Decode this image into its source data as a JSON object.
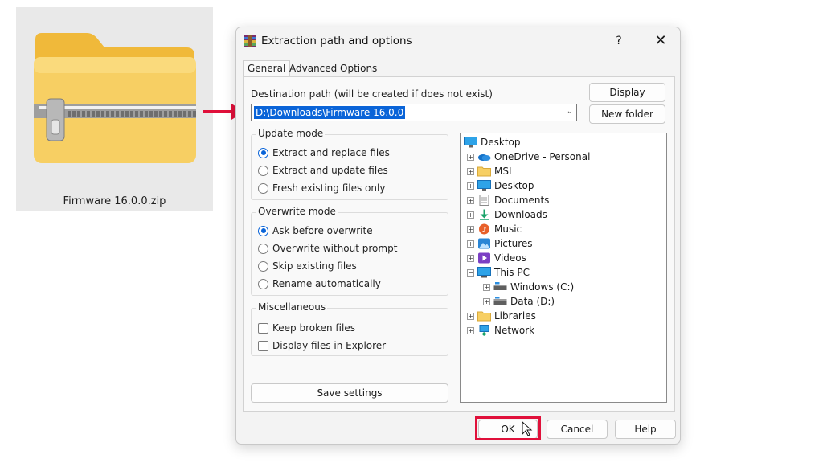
{
  "file_preview": {
    "name": "Firmware 16.0.0.zip",
    "icon": "zip-folder-icon"
  },
  "annotation": {
    "arrow_color": "#e0103a",
    "highlight_color": "#e0103a"
  },
  "dialog": {
    "title": "Extraction path and options",
    "help_label": "?",
    "close_label": "✕",
    "tabs": [
      {
        "label": "General",
        "active": true
      },
      {
        "label": "Advanced",
        "active": false
      },
      {
        "label": "Options",
        "active": false
      }
    ],
    "destination": {
      "label": "Destination path (will be created if does not exist)",
      "value": "D:\\Downloads\\Firmware 16.0.0"
    },
    "buttons": {
      "display": "Display",
      "new_folder": "New folder",
      "save_settings": "Save settings"
    },
    "update_mode": {
      "title": "Update mode",
      "options": [
        {
          "label": "Extract and replace files",
          "selected": true
        },
        {
          "label": "Extract and update files",
          "selected": false
        },
        {
          "label": "Fresh existing files only",
          "selected": false
        }
      ]
    },
    "overwrite_mode": {
      "title": "Overwrite mode",
      "options": [
        {
          "label": "Ask before overwrite",
          "selected": true
        },
        {
          "label": "Overwrite without prompt",
          "selected": false
        },
        {
          "label": "Skip existing files",
          "selected": false
        },
        {
          "label": "Rename automatically",
          "selected": false
        }
      ]
    },
    "miscellaneous": {
      "title": "Miscellaneous",
      "options": [
        {
          "label": "Keep broken files",
          "checked": false
        },
        {
          "label": "Display files in Explorer",
          "checked": false
        }
      ]
    },
    "tree": [
      {
        "label": "Desktop",
        "icon": "desktop-icon",
        "level": 0,
        "expander": ""
      },
      {
        "label": "OneDrive - Personal",
        "icon": "onedrive-icon",
        "level": 1,
        "expander": "+"
      },
      {
        "label": "MSI",
        "icon": "folder-icon",
        "level": 1,
        "expander": "+"
      },
      {
        "label": "Desktop",
        "icon": "desktop-icon",
        "level": 1,
        "expander": "+"
      },
      {
        "label": "Documents",
        "icon": "documents-icon",
        "level": 1,
        "expander": "+"
      },
      {
        "label": "Downloads",
        "icon": "downloads-icon",
        "level": 1,
        "expander": "+"
      },
      {
        "label": "Music",
        "icon": "music-icon",
        "level": 1,
        "expander": "+"
      },
      {
        "label": "Pictures",
        "icon": "pictures-icon",
        "level": 1,
        "expander": "+"
      },
      {
        "label": "Videos",
        "icon": "videos-icon",
        "level": 1,
        "expander": "+"
      },
      {
        "label": "This PC",
        "icon": "pc-icon",
        "level": 1,
        "expander": "−"
      },
      {
        "label": "Windows (C:)",
        "icon": "drive-icon",
        "level": 2,
        "expander": "+"
      },
      {
        "label": "Data (D:)",
        "icon": "drive-icon",
        "level": 2,
        "expander": "+"
      },
      {
        "label": "Libraries",
        "icon": "folder-icon",
        "level": 1,
        "expander": "+"
      },
      {
        "label": "Network",
        "icon": "network-icon",
        "level": 1,
        "expander": "+"
      }
    ],
    "footer": {
      "ok": "OK",
      "cancel": "Cancel",
      "help": "Help"
    }
  }
}
